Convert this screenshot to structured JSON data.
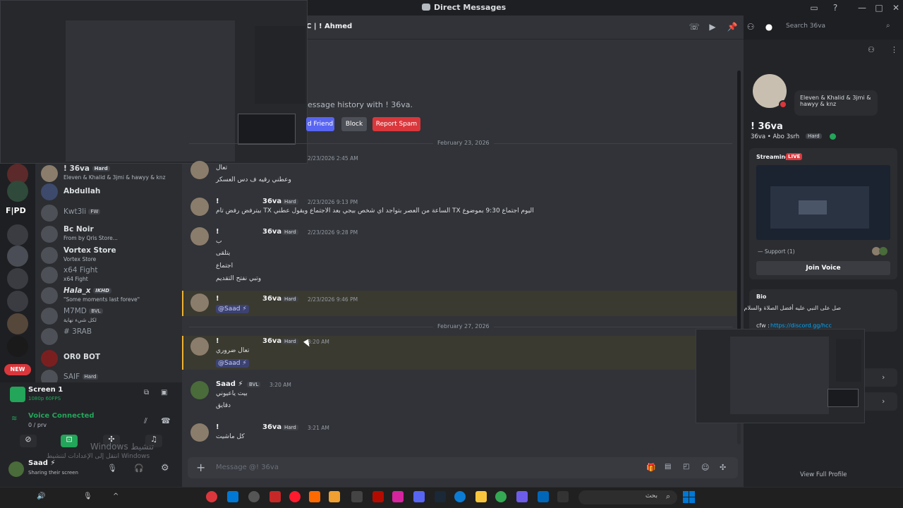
{
  "window": {
    "title": "Direct Messages"
  },
  "header": {
    "channel_name": "C | ! Ahmed",
    "search_placeholder": "Search 36va"
  },
  "intro": {
    "text": "essage history with ! 36va.",
    "add_friend": "d Friend",
    "block": "Block",
    "report_spam": "Report Spam"
  },
  "dividers": {
    "d1": "February 23, 2026",
    "d2": "February 27, 2026"
  },
  "messages": [
    {
      "prefix": "!",
      "user": "36va",
      "tag": "Hard",
      "time": "2/23/2026 9:13 PM",
      "lines": [
        "اليوم اجتماع 9:30 بموضوع TX الساعة من العصر بتواجد اي شخص بيجي بعد الاجتماع ويقول عطني TX بيترفض رفض تام"
      ]
    },
    {
      "prefix": "!",
      "user": "36va",
      "tag": "Hard",
      "time": "2/23/2026 9:28 PM",
      "lines": [
        "ب",
        "يتلقى",
        "اجتماع",
        "وتبي نفتح التقديم"
      ]
    },
    {
      "prefix": "!",
      "user": "36va",
      "tag": "Hard",
      "time": "2/23/2026 9:46 PM",
      "mention": "@Saad ⚡"
    },
    {
      "prefix": "!",
      "user": "36va",
      "tag": "Hard",
      "time": "3:20 AM",
      "lines": [
        "تعال ضروري"
      ],
      "mention": "@Saad ⚡"
    },
    {
      "prefix": "",
      "user": "Saad ⚡",
      "tag": "BVL",
      "time": "3:20 AM",
      "lines": [
        "بيت ياعيوني",
        "دقايق"
      ]
    },
    {
      "prefix": "!",
      "user": "36va",
      "tag": "Hard",
      "time": "3:21 AM",
      "lines": [
        "كل ماشيت"
      ]
    }
  ],
  "early_lines": {
    "l1": "تعال",
    "l2": "وعطني رقيه ف دس العسكر",
    "time0": "2/23/2026 2:45 AM"
  },
  "input": {
    "placeholder": "Message @! 36va"
  },
  "dms": [
    {
      "name": "! 36va",
      "tag": "Hard",
      "sub": "Eleven & Khalid & 3jmi & hawyy & knz"
    },
    {
      "name": "Abdullah",
      "sub": ""
    },
    {
      "name": "Kwt3li",
      "tag": "FW",
      "sub": ""
    },
    {
      "name": "Bc Noir",
      "sub": "From by Qris Store..."
    },
    {
      "name": "Vortex Store",
      "sub": "Vortex Store"
    },
    {
      "name": "x64 Fight",
      "sub": "x64 Fight"
    },
    {
      "name": "Hala_x",
      "tag": "IKHD",
      "sub": "\"Some moments last foreve\""
    },
    {
      "name": "M7MD",
      "tag": "BVL",
      "sub": "لكل شيء نهاية"
    },
    {
      "name": "# 3RAB",
      "sub": ""
    },
    {
      "name": "OR0 BOT",
      "sub": ""
    },
    {
      "name": "SAIF",
      "tag": "Hard",
      "sub": ""
    }
  ],
  "guild_labels": {
    "fpd": "F|PD",
    "new": "NEW"
  },
  "screen_share": {
    "title": "Screen 1",
    "sub": "1080p 60FPS"
  },
  "voice": {
    "status": "Voice Connected",
    "channel": "0 / prv"
  },
  "user_panel": {
    "name": "Saad ⚡",
    "status": "Sharing their screen"
  },
  "watermark": {
    "l1": "Windows تنشيط",
    "l2": "انتقل إلى الإعدادات لتنشيط Windows"
  },
  "profile": {
    "group_text": "Eleven & Khalid & 3jmi & hawyy & knz",
    "display_name": "! 36va",
    "username": "36va • Abo 3srh",
    "tag": "Hard",
    "streaming_label": "Streaming",
    "live": "LIVE",
    "support_text": "— Support (1)",
    "join_voice": "Join Voice",
    "bio_label": "Bio",
    "bio_text": "صل على النبي عليه أفضل الصلاة والسلام",
    "cfw_label": "cfw :",
    "cfw_link": "https://discord.gg/hcc",
    "view_full": "View Full Profile"
  },
  "taskbar": {
    "search": "بحث"
  },
  "colors": {
    "blurple": "#5865f2",
    "red": "#da373c",
    "green": "#23a55a"
  }
}
